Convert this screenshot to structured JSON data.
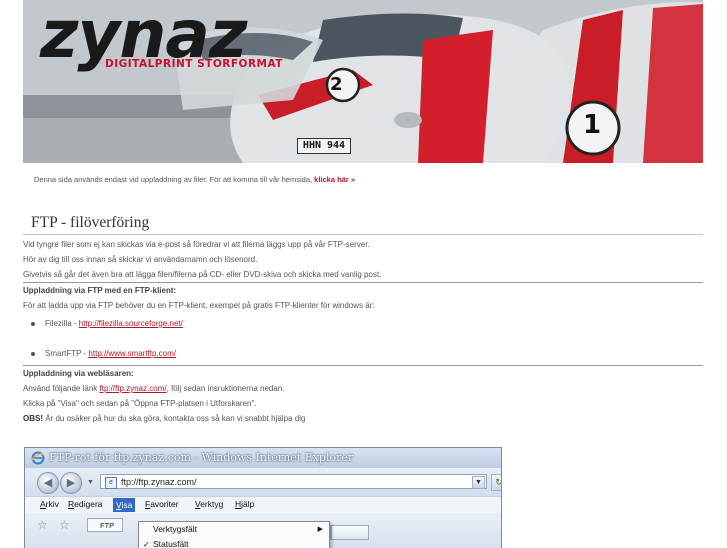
{
  "banner": {
    "logo_word": "zynaz",
    "logo_tagline": "DIGITALPRINT STORFORMAT",
    "car_numbers": [
      "2",
      "1"
    ],
    "plate_text": "HHN 944",
    "colors": {
      "red": "#d21f2b",
      "silver": "#c9cdd0"
    }
  },
  "notice": {
    "text": "Denna sida används endast vid uppladdning av filer. För att komma till vår hemsida,",
    "link_label": "klicka här »"
  },
  "main": {
    "title": "FTP - filöverföring",
    "intro": [
      "Vid tyngre filer som ej kan skickas via e-post så föredrar vi att filerna läggs upp på vår FTP-server.",
      "Hör av dig till oss innan så skickar vi användarnamn och lösenord.",
      "Givetvis så går det även bra att lägga filen/filerna på CD- eller DVD-skiva och skicka med vanlig post."
    ],
    "section_client": {
      "heading": "Uppladdning via FTP med en FTP-klient:",
      "text": "För att ladda upp via FTP behöver du en FTP-klient, exempel på gratis FTP-klienter för windows är:",
      "clients": [
        {
          "name": "Filezilla - ",
          "url": "http://filezilla.sourceforge.net/"
        },
        {
          "name": "SmartFTP - ",
          "url": "http://www.smartftp.com/"
        }
      ]
    },
    "section_browser": {
      "heading": "Uppladdning via webläsaren:",
      "line1_before": "Använd följande länk ",
      "line1_link": "ftp://ftp.zynaz.com/",
      "line1_after": ", följ sedan insruktionerna nedan.",
      "line2": "Klicka på \"Visa\" och sedan på \"Öppna FTP-platsen i Utforskaren\".",
      "obs_label": "OBS!",
      "obs_text": " Är du osäker på hur du ska göra, kontakta oss så kan vi snabbt hjälpa dig"
    }
  },
  "ie_screenshot": {
    "window_title": "FTP-rot för ftp.zynaz.com - Windows Internet Explorer",
    "address": "ftp://ftp.zynaz.com/",
    "menu": [
      {
        "pre": "",
        "u": "A",
        "post": "rkiv"
      },
      {
        "pre": "",
        "u": "R",
        "post": "edigera"
      },
      {
        "pre": "",
        "u": "V",
        "post": "isa"
      },
      {
        "pre": "",
        "u": "F",
        "post": "avoriter"
      },
      {
        "pre": "",
        "u": "V",
        "post": "erktyg"
      },
      {
        "pre": "",
        "u": "H",
        "post": "jälp"
      }
    ],
    "active_menu_index": 2,
    "dropdown_items": [
      "Verktygsfält",
      "Statusfält"
    ],
    "favorite_tab": "FTP"
  }
}
